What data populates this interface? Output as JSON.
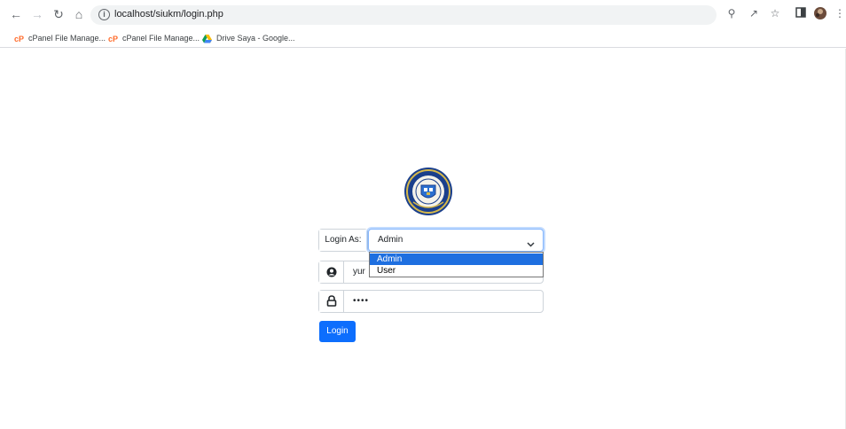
{
  "browser": {
    "url": "localhost/siukm/login.php",
    "bookmarks": [
      {
        "label": "cPanel File Manage...",
        "icon": "cpanel-icon"
      },
      {
        "label": "cPanel File Manage...",
        "icon": "cpanel-icon"
      },
      {
        "label": "Drive Saya - Google...",
        "icon": "google-drive-icon"
      }
    ]
  },
  "login": {
    "login_as_label": "Login As:",
    "login_as_selected": "Admin",
    "login_as_options": [
      "Admin",
      "User"
    ],
    "username_value": "yur",
    "password_value": "••••",
    "submit_label": "Login"
  },
  "colors": {
    "primary": "#0d6efd",
    "option_highlight": "#1e6fe0",
    "focus_border": "#86b7fe"
  }
}
